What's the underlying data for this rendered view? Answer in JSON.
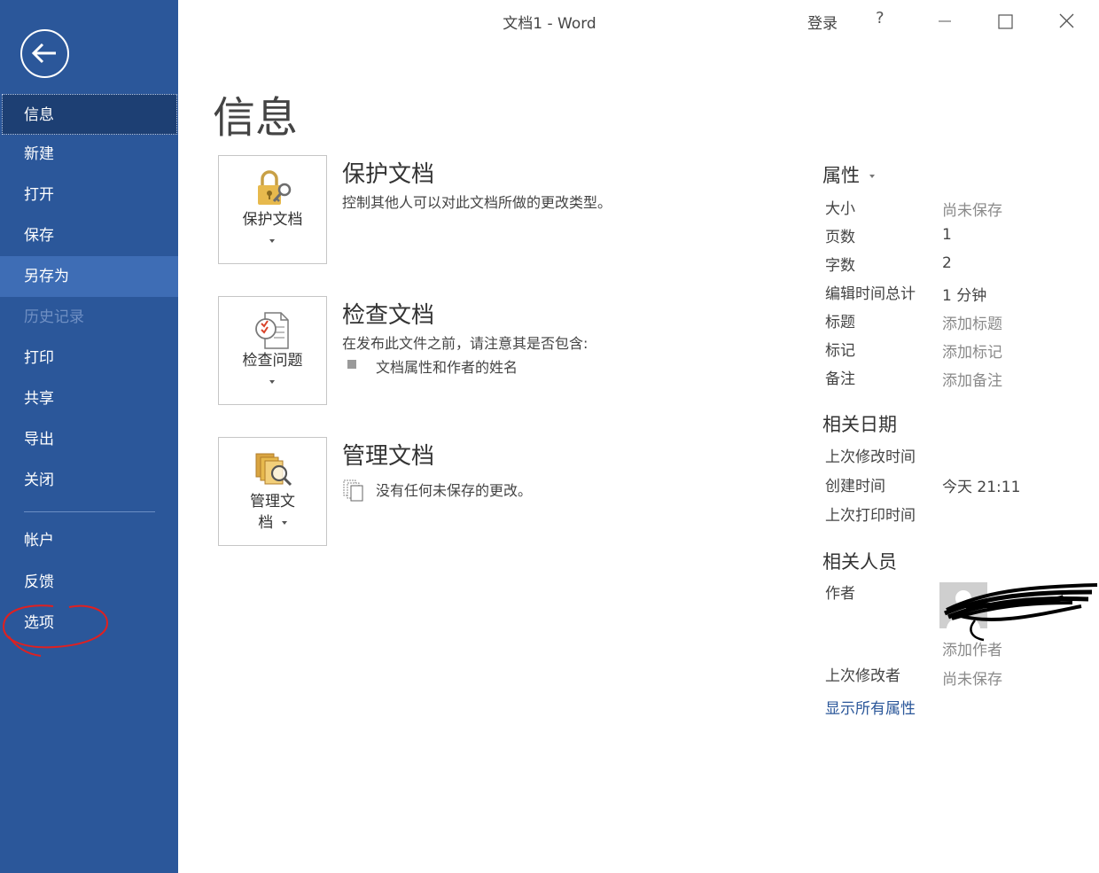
{
  "window": {
    "title": "文档1  -  Word",
    "login": "登录",
    "help": "?"
  },
  "sidebar": {
    "items": [
      {
        "label": "信息"
      },
      {
        "label": "新建"
      },
      {
        "label": "打开"
      },
      {
        "label": "保存"
      },
      {
        "label": "另存为"
      },
      {
        "label": "历史记录"
      },
      {
        "label": "打印"
      },
      {
        "label": "共享"
      },
      {
        "label": "导出"
      },
      {
        "label": "关闭"
      },
      {
        "label": "帐户"
      },
      {
        "label": "反馈"
      },
      {
        "label": "选项"
      }
    ],
    "accent_color": "#2b579a"
  },
  "main": {
    "page_title": "信息",
    "sections": [
      {
        "tile_label": "保护文档",
        "title": "保护文档",
        "description": "控制其他人可以对此文档所做的更改类型。"
      },
      {
        "tile_label": "检查问题",
        "title": "检查文档",
        "description": "在发布此文件之前，请注意其是否包含:",
        "bullet": "文档属性和作者的姓名"
      },
      {
        "tile_label_line1": "管理文",
        "tile_label_line2": "档",
        "title": "管理文档",
        "description": "没有任何未保存的更改。"
      }
    ]
  },
  "properties": {
    "heading": "属性",
    "rows": [
      {
        "label": "大小",
        "value": "尚未保存"
      },
      {
        "label": "页数",
        "value": "1"
      },
      {
        "label": "字数",
        "value": "2"
      },
      {
        "label": "编辑时间总计",
        "value": "1 分钟"
      },
      {
        "label": "标题",
        "value": "添加标题"
      },
      {
        "label": "标记",
        "value": "添加标记"
      },
      {
        "label": "备注",
        "value": "添加备注"
      }
    ],
    "dates_heading": "相关日期",
    "dates": [
      {
        "label": "上次修改时间",
        "value": ""
      },
      {
        "label": "创建时间",
        "value": "今天 21:11"
      },
      {
        "label": "上次打印时间",
        "value": ""
      }
    ],
    "people_heading": "相关人员",
    "author_label": "作者",
    "add_author": "添加作者",
    "last_modified_by_label": "上次修改者",
    "last_modified_by_value": "尚未保存",
    "show_all": "显示所有属性"
  }
}
